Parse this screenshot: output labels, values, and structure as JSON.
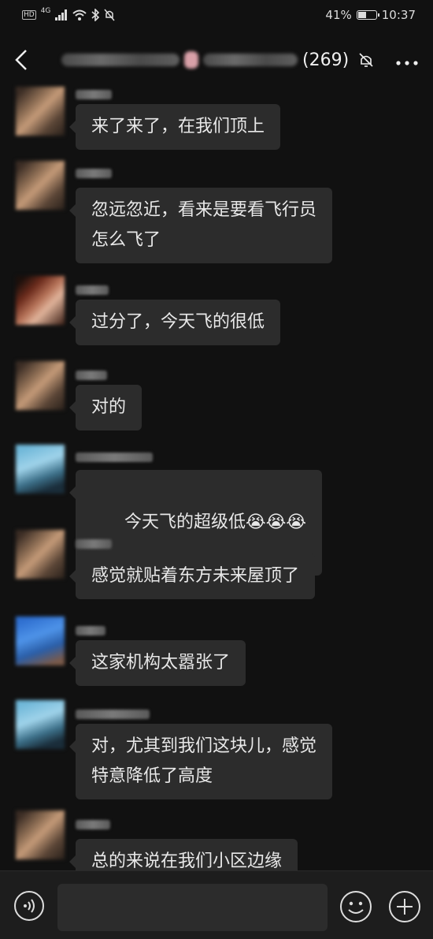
{
  "status_bar": {
    "hd": "HD",
    "network": "4G",
    "battery": "41%",
    "battery_level": 0.41,
    "time": "10:37"
  },
  "header": {
    "member_count": "(269)",
    "icons": [
      "back-icon",
      "mute-bell-icon",
      "more-icon"
    ]
  },
  "messages": [
    {
      "text": "来了来了，在我们顶上"
    },
    {
      "text": "忽远忽近，看来是要看飞行员\n怎么飞了"
    },
    {
      "text": "过分了，今天飞的很低"
    },
    {
      "text": "对的"
    },
    {
      "text": "今天飞的超级低",
      "emoji": "😭😭😭"
    },
    {
      "text": "感觉就贴着东方未来屋顶了"
    },
    {
      "text": "这家机构太嚣张了"
    },
    {
      "text": "对，尤其到我们这块儿，感觉\n特意降低了高度"
    },
    {
      "text": "总的来说在我们小区边缘"
    }
  ],
  "input_bar": {
    "icons": [
      "voice-icon",
      "emoji-icon",
      "plus-icon"
    ]
  }
}
